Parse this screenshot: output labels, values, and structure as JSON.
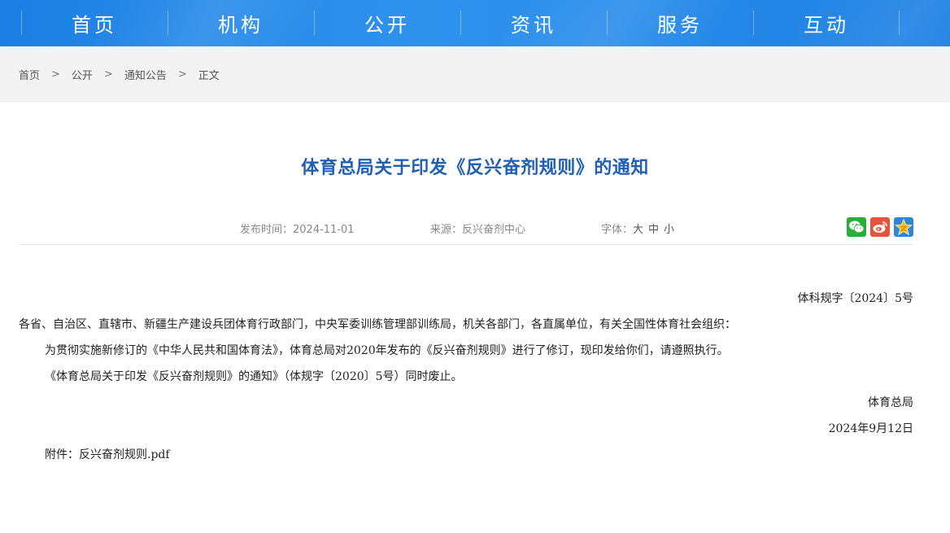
{
  "nav": {
    "items": [
      "首页",
      "机构",
      "公开",
      "资讯",
      "服务",
      "互动"
    ]
  },
  "breadcrumb": {
    "items": [
      "首页",
      "公开",
      "通知公告",
      "正文"
    ],
    "separator": ">"
  },
  "article": {
    "title": "体育总局关于印发《反兴奋剂规则》的通知",
    "meta": {
      "publish_label": "发布时间：",
      "publish_date": "2024-11-01",
      "source_label": "来源：",
      "source": "反兴奋剂中心",
      "font_label": "字体：",
      "font_sizes": [
        "大",
        "中",
        "小"
      ]
    },
    "share_icons": [
      "wechat-icon",
      "weibo-icon",
      "qzone-icon"
    ],
    "doc_number": "体科规字〔2024〕5号",
    "addressee": "各省、自治区、直辖市、新疆生产建设兵团体育行政部门，中央军委训练管理部训练局，机关各部门，各直属单位，有关全国性体育社会组织：",
    "paragraphs": [
      "为贯彻实施新修订的《中华人民共和国体育法》，体育总局对2020年发布的《反兴奋剂规则》进行了修订，现印发给你们，请遵照执行。",
      "《体育总局关于印发《反兴奋剂规则》的通知》（体规字〔2020〕5号）同时废止。"
    ],
    "signature": "体育总局",
    "date": "2024年9月12日",
    "attachment_label": "附件：",
    "attachment_name": "反兴奋剂规则.pdf"
  },
  "colors": {
    "nav_bg": "#1c7fe3",
    "title": "#1f5fb8",
    "wechat": "#2aae3a",
    "weibo": "#e6553b",
    "qzone": "#2f86d6"
  }
}
